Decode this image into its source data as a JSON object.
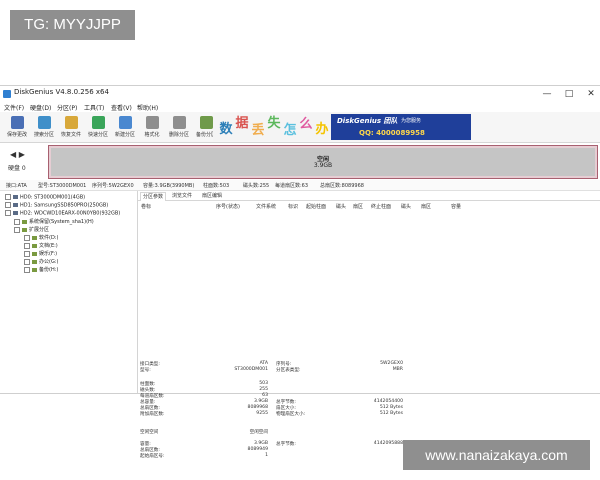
{
  "watermarks": {
    "top": "TG: MYYJJPP",
    "bottom": "www.nanaizakaya.com"
  },
  "window": {
    "title": "DiskGenius V4.8.0.256 x64",
    "minimize": "—",
    "maximize": "□",
    "close": "✕"
  },
  "menu": [
    "文件(F)",
    "硬盘(D)",
    "分区(P)",
    "工具(T)",
    "查看(V)",
    "帮助(H)"
  ],
  "toolbar": [
    {
      "label": "保存更改",
      "color": "#4a6fb5"
    },
    {
      "label": "搜索分区",
      "color": "#3f8fc9"
    },
    {
      "label": "恢复文件",
      "color": "#d8a83a"
    },
    {
      "label": "快速分区",
      "color": "#3aa55a"
    },
    {
      "label": "新建分区",
      "color": "#4a88d0"
    },
    {
      "label": "格式化",
      "color": "#8e8e8e"
    },
    {
      "label": "删除分区",
      "color": "#8e8e8e"
    },
    {
      "label": "备份分区",
      "color": "#6f9a4a"
    }
  ],
  "banner": {
    "chars": [
      {
        "text": "数",
        "color": "#2c7fb8"
      },
      {
        "text": "据",
        "color": "#d9534f"
      },
      {
        "text": "丢",
        "color": "#f0ad4e"
      },
      {
        "text": "失",
        "color": "#5cb85c"
      },
      {
        "text": "怎",
        "color": "#5bc0de"
      },
      {
        "text": "么",
        "color": "#e05aa0"
      },
      {
        "text": "办",
        "color": "#f5c400"
      }
    ],
    "brand": "DiskGenius 团队",
    "brand_sub": "为您服务",
    "qq": "QQ: 4000089958"
  },
  "diskbar": {
    "label": "硬盘 0",
    "free_label": "空闲",
    "free_size": "3.9GB"
  },
  "info_line": [
    "接口:ATA",
    "型号:ST3000DM001",
    "序列号:5W2GEX0",
    "容量:3.9GB(3990MB)",
    "柱面数:503",
    "磁头数:255",
    "每道扇区数:63",
    "总扇区数:8089968"
  ],
  "tree": {
    "items": [
      {
        "text": "HD0: ST3000DM001(4GB)",
        "level": 0
      },
      {
        "text": "HD1: SamsungSSD850PRO(250GB)",
        "level": 0
      },
      {
        "text": "HD2: WDCWD10EARX-00N0YB0(932GB)",
        "level": 0
      },
      {
        "text": "系统保留(System_sha1)(H)",
        "level": 1
      },
      {
        "text": "扩展分区",
        "level": 1
      },
      {
        "text": "软件(D:)",
        "level": 2
      },
      {
        "text": "文档(E:)",
        "level": 2
      },
      {
        "text": "娱乐(F:)",
        "level": 2
      },
      {
        "text": "办公(G:)",
        "level": 2
      },
      {
        "text": "备份(H:)",
        "level": 2
      }
    ]
  },
  "panel": {
    "tabs": [
      "分区参数",
      "浏览文件",
      "扇区编辑"
    ],
    "columns": [
      "卷标",
      "序号(状态)",
      "文件系统",
      "标识",
      "起始柱面",
      "磁头",
      "扇区",
      "终止柱面",
      "磁头",
      "扇区",
      "容量"
    ],
    "details": {
      "left1": [
        {
          "k": "接口类型:",
          "v": "ATA"
        },
        {
          "k": "型号:",
          "v": "ST3000DM001"
        }
      ],
      "right1": [
        {
          "k": "序列号:",
          "v": "5W2GEX0"
        },
        {
          "k": "分区表类型:",
          "v": "MBR"
        }
      ],
      "left2": [
        {
          "k": "柱面数:",
          "v": "503"
        },
        {
          "k": "磁头数:",
          "v": "255"
        },
        {
          "k": "每道扇区数:",
          "v": "63"
        },
        {
          "k": "总容量:",
          "v": "3.9GB"
        },
        {
          "k": "总扇区数:",
          "v": "8089968"
        },
        {
          "k": "附加扇区数:",
          "v": "9255"
        }
      ],
      "right2": [
        {
          "k": "总字节数:",
          "v": "4142054400"
        },
        {
          "k": "扇区大小:",
          "v": "512 Bytes"
        },
        {
          "k": "物理扇区大小:",
          "v": "512 Bytes"
        }
      ],
      "free_header": {
        "k": "空闲空间",
        "v": "空闲空间"
      },
      "left3": [
        {
          "k": "容量:",
          "v": "3.9GB"
        },
        {
          "k": "总扇区数:",
          "v": "8089949"
        },
        {
          "k": "起始扇区号:",
          "v": "1"
        }
      ],
      "right3": [
        {
          "k": "总字节数:",
          "v": "4142095888"
        }
      ]
    }
  }
}
